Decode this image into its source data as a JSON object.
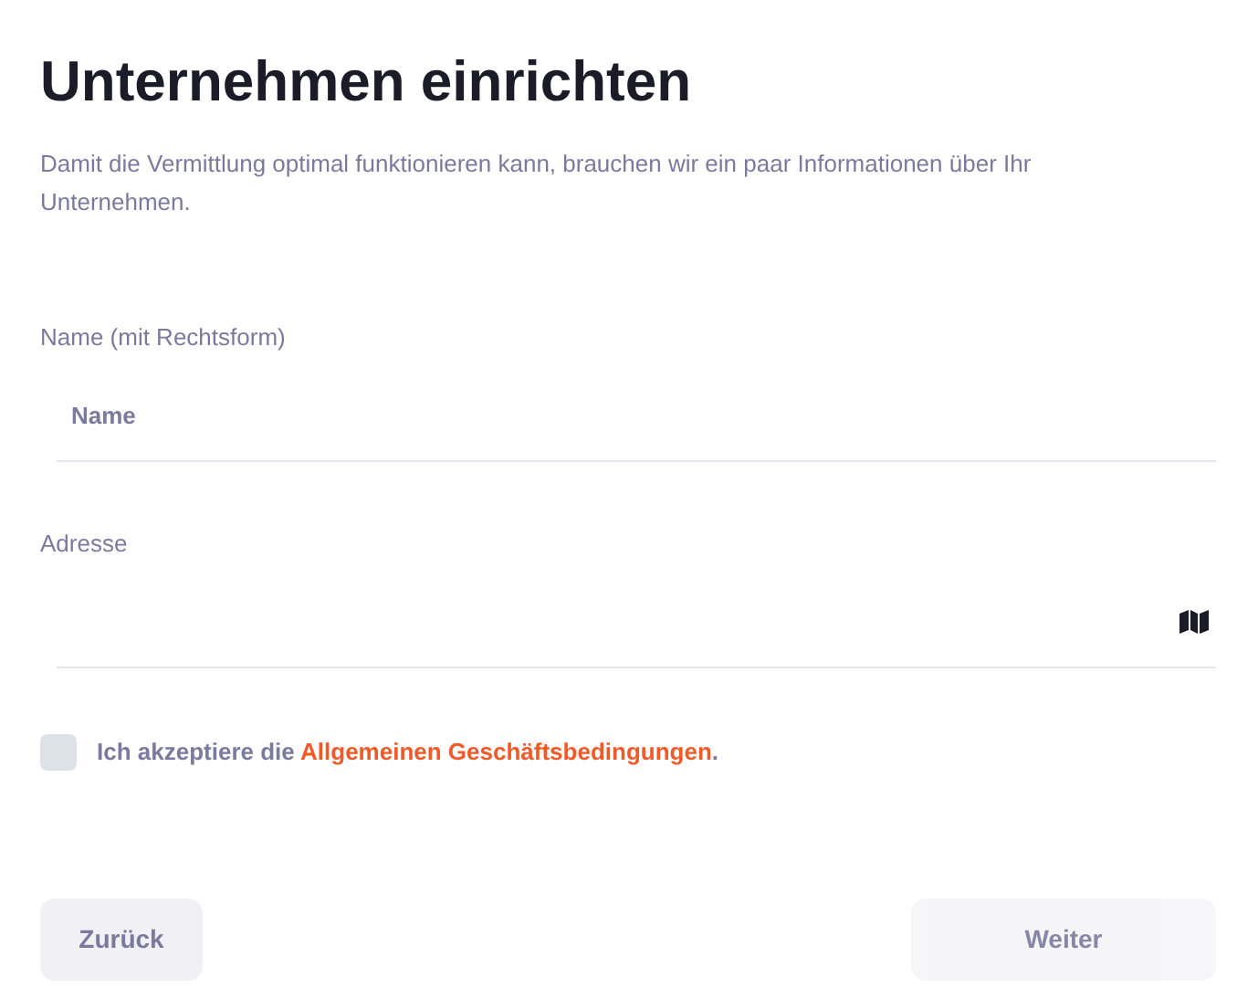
{
  "title": "Unternehmen einrichten",
  "description": "Damit die Vermittlung optimal funktionieren kann, brauchen wir ein paar Informationen über Ihr Unternehmen.",
  "fields": [
    {
      "label": "Name (mit Rechtsform)",
      "placeholder": "Name",
      "kind": "text"
    },
    {
      "label": "Adresse",
      "kind": "address"
    }
  ],
  "terms": {
    "checked": false,
    "text_before": "Ich akzeptiere die",
    "link": "Allgemeinen Geschäftsbedingungen",
    "text_after": "."
  },
  "buttons": [
    {
      "label": "Zurück",
      "disabled": false
    },
    {
      "label": "Weiter",
      "disabled": true
    }
  ]
}
